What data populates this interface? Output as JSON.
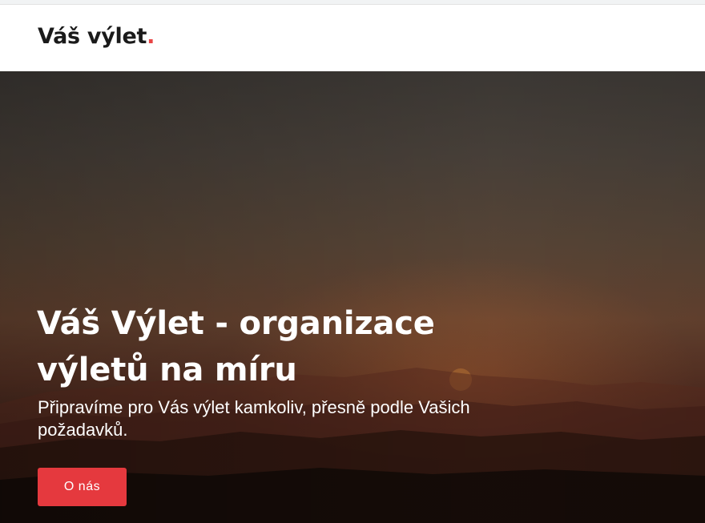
{
  "header": {
    "logo_text": "Váš výlet",
    "logo_dot": "."
  },
  "hero": {
    "title": "Váš Výlet - organizace výletů na míru",
    "subtitle": "Připravíme pro Vás výlet kamkoliv, přesně podle Vašich požadavků.",
    "button_label": "O nás"
  },
  "colors": {
    "accent": "#e5393e",
    "logo_text": "#1a1a1a",
    "hero_text": "#ffffff"
  }
}
